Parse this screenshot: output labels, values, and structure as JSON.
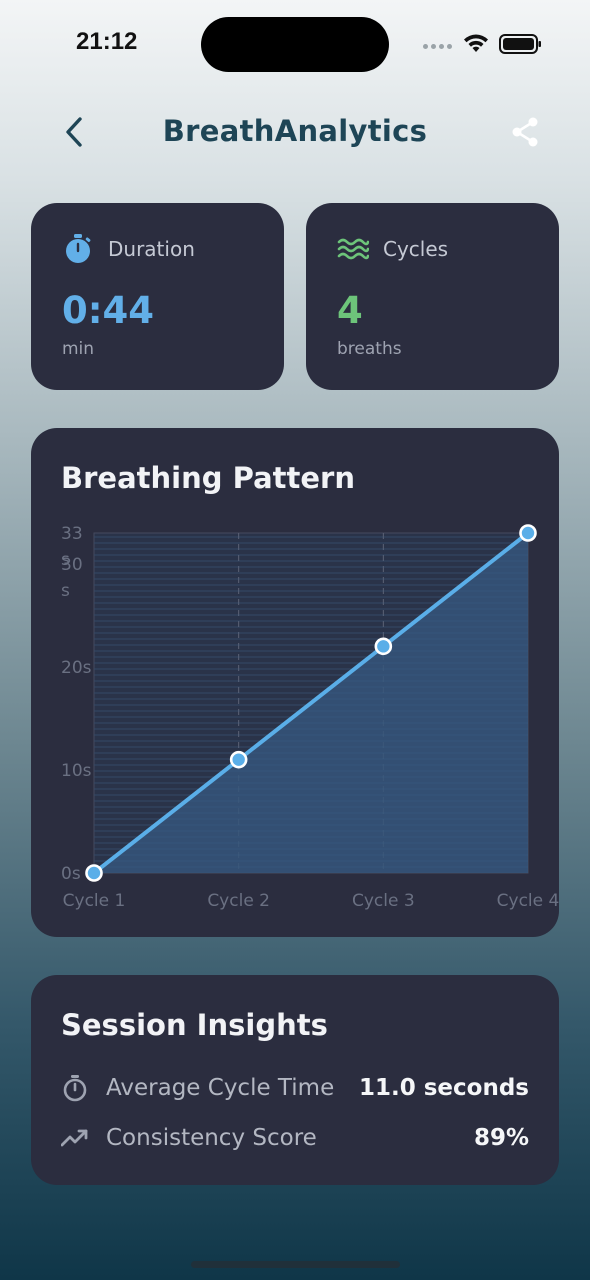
{
  "status_bar": {
    "time": "21:12"
  },
  "nav": {
    "title": "BreathAnalytics",
    "back_icon": "chevron-left-icon",
    "share_icon": "share-icon"
  },
  "stats": {
    "duration": {
      "label": "Duration",
      "value": "0:44",
      "unit": "min",
      "icon": "stopwatch-icon",
      "color": "#62afe8"
    },
    "cycles": {
      "label": "Cycles",
      "value": "4",
      "unit": "breaths",
      "icon": "waves-icon",
      "color": "#6dc47a"
    }
  },
  "chart": {
    "title": "Breathing Pattern"
  },
  "chart_data": {
    "type": "area",
    "title": "Breathing Pattern",
    "categories": [
      "Cycle 1",
      "Cycle 2",
      "Cycle 3",
      "Cycle 4"
    ],
    "values": [
      0,
      11,
      22,
      33
    ],
    "y_ticks": [
      "0s",
      "10s",
      "20s",
      "30\ns",
      "33\ns"
    ],
    "y_tick_values": [
      0,
      10,
      20,
      30,
      33
    ],
    "ylim": [
      0,
      33
    ],
    "grid": true,
    "line_color": "#5aaee8",
    "fill_color": "#35557a"
  },
  "insights": {
    "title": "Session Insights",
    "rows": [
      {
        "label": "Average Cycle Time",
        "value": "11.0 seconds",
        "icon": "timer-icon"
      },
      {
        "label": "Consistency Score",
        "value": "89%",
        "icon": "trending-up-icon"
      }
    ]
  }
}
